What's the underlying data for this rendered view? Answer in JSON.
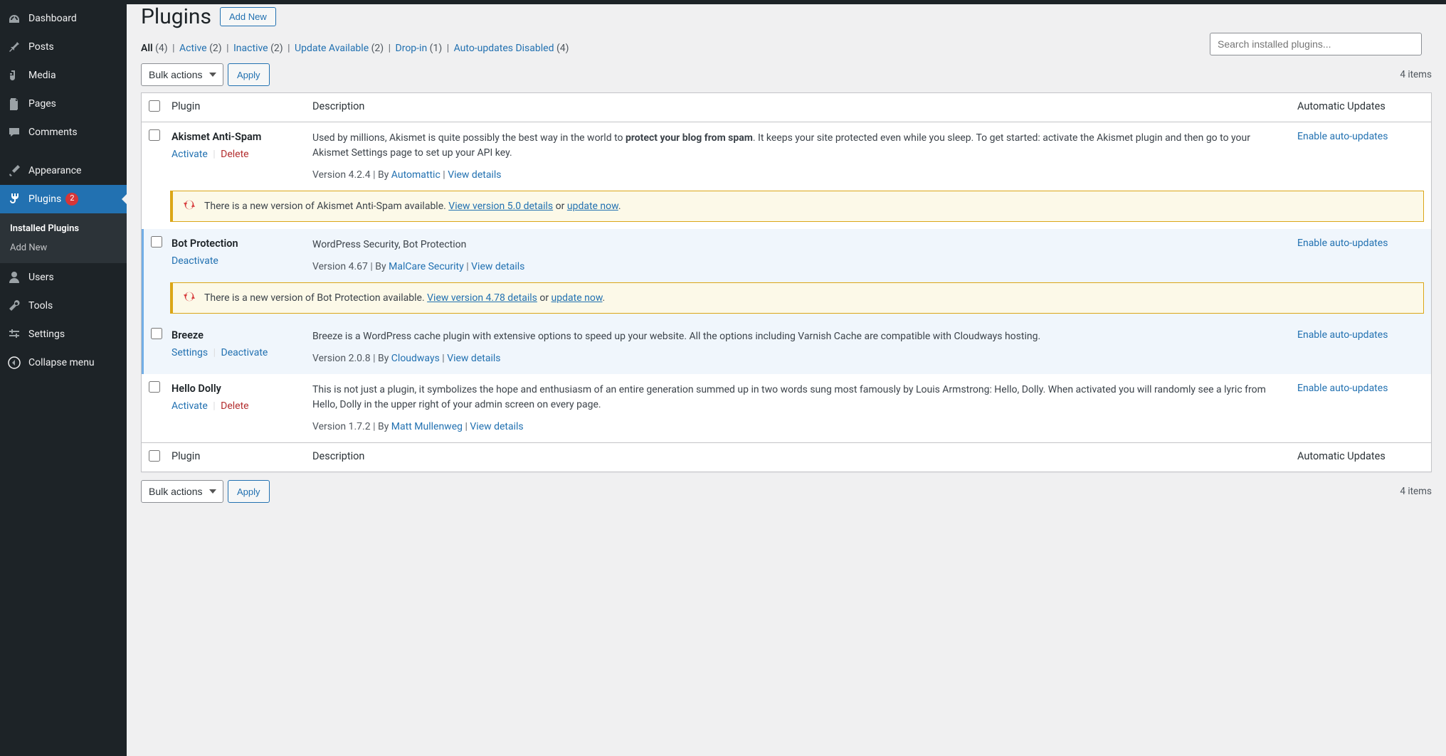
{
  "sidebar": {
    "items": [
      {
        "icon": "dashboard",
        "label": "Dashboard"
      },
      {
        "icon": "pin",
        "label": "Posts"
      },
      {
        "icon": "media",
        "label": "Media"
      },
      {
        "icon": "page",
        "label": "Pages"
      },
      {
        "icon": "comment",
        "label": "Comments"
      },
      {
        "icon": "brush",
        "label": "Appearance"
      },
      {
        "icon": "plug",
        "label": "Plugins",
        "badge": "2",
        "current": true
      },
      {
        "icon": "user",
        "label": "Users"
      },
      {
        "icon": "wrench",
        "label": "Tools"
      },
      {
        "icon": "sliders",
        "label": "Settings"
      },
      {
        "icon": "collapse",
        "label": "Collapse menu"
      }
    ],
    "submenu": [
      {
        "label": "Installed Plugins",
        "current": true
      },
      {
        "label": "Add New"
      }
    ]
  },
  "page": {
    "title": "Plugins",
    "add_new": "Add New",
    "search_placeholder": "Search installed plugins...",
    "items_count": "4 items",
    "bulk_label": "Bulk actions",
    "apply": "Apply"
  },
  "filters": [
    {
      "label": "All",
      "count": "(4)",
      "current": true
    },
    {
      "label": "Active",
      "count": "(2)"
    },
    {
      "label": "Inactive",
      "count": "(2)"
    },
    {
      "label": "Update Available",
      "count": "(2)"
    },
    {
      "label": "Drop-in",
      "count": "(1)"
    },
    {
      "label": "Auto-updates Disabled",
      "count": "(4)"
    }
  ],
  "columns": {
    "plugin": "Plugin",
    "description": "Description",
    "auto": "Automatic Updates"
  },
  "enable_auto_label": "Enable auto-updates",
  "plugins": [
    {
      "name": "Akismet Anti-Spam",
      "active": false,
      "actions": [
        {
          "type": "activate",
          "label": "Activate"
        },
        {
          "type": "delete",
          "label": "Delete"
        }
      ],
      "desc_pre": "Used by millions, Akismet is quite possibly the best way in the world to ",
      "desc_strong": "protect your blog from spam",
      "desc_post": ". It keeps your site protected even while you sleep. To get started: activate the Akismet plugin and then go to your Akismet Settings page to set up your API key.",
      "version": "Version 4.2.4",
      "author": "Automattic",
      "view_details": "View details",
      "update": {
        "text_pre": "There is a new version of Akismet Anti-Spam available. ",
        "view_link": "View version 5.0 details",
        "or": " or ",
        "update_now": "update now",
        "period": "."
      }
    },
    {
      "name": "Bot Protection",
      "active": true,
      "actions": [
        {
          "type": "deactivate",
          "label": "Deactivate"
        }
      ],
      "desc_plain": "WordPress Security, Bot Protection",
      "version": "Version 4.67",
      "author": "MalCare Security",
      "view_details": "View details",
      "update": {
        "text_pre": "There is a new version of Bot Protection available. ",
        "view_link": "View version 4.78 details",
        "or": " or ",
        "update_now": "update now",
        "period": "."
      }
    },
    {
      "name": "Breeze",
      "active": true,
      "actions": [
        {
          "type": "settings",
          "label": "Settings"
        },
        {
          "type": "deactivate",
          "label": "Deactivate"
        }
      ],
      "desc_plain": "Breeze is a WordPress cache plugin with extensive options to speed up your website. All the options including Varnish Cache are compatible with Cloudways hosting.",
      "version": "Version 2.0.8",
      "author": "Cloudways",
      "view_details": "View details"
    },
    {
      "name": "Hello Dolly",
      "active": false,
      "actions": [
        {
          "type": "activate",
          "label": "Activate"
        },
        {
          "type": "delete",
          "label": "Delete"
        }
      ],
      "desc_plain": "This is not just a plugin, it symbolizes the hope and enthusiasm of an entire generation summed up in two words sung most famously by Louis Armstrong: Hello, Dolly. When activated you will randomly see a lyric from Hello, Dolly in the upper right of your admin screen on every page.",
      "version": "Version 1.7.2",
      "author": "Matt Mullenweg",
      "view_details": "View details"
    }
  ]
}
